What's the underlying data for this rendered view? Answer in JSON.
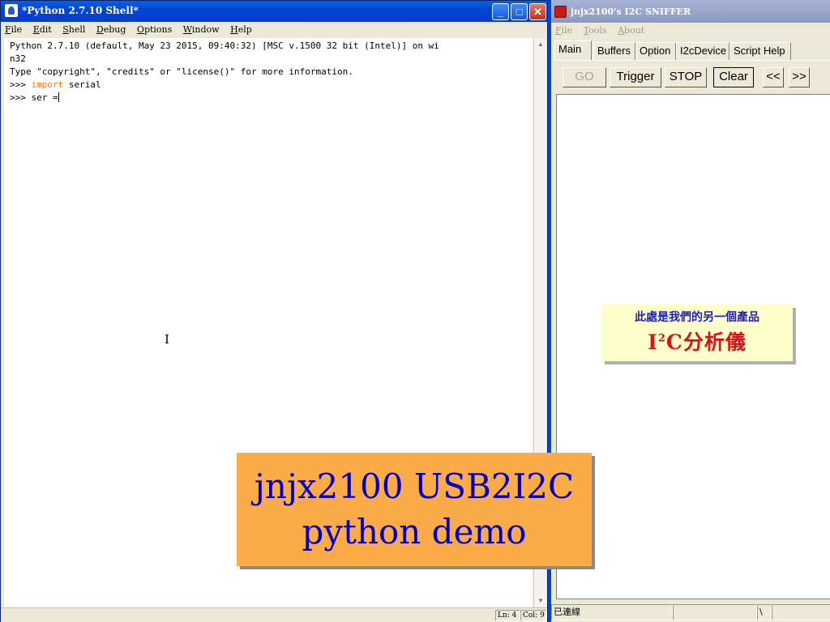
{
  "idle": {
    "title": "*Python 2.7.10 Shell*",
    "window_buttons": {
      "minimize": "_",
      "maximize": "□",
      "close": "✕"
    },
    "menu": [
      "File",
      "Edit",
      "Shell",
      "Debug",
      "Options",
      "Window",
      "Help"
    ],
    "shell_lines": [
      {
        "prompt": "",
        "keyword": "",
        "text": "Python 2.7.10 (default, May 23 2015, 09:40:32) [MSC v.1500 32 bit (Intel)] on wi"
      },
      {
        "prompt": "",
        "keyword": "",
        "text": "n32"
      },
      {
        "prompt": "",
        "keyword": "",
        "text": "Type \"copyright\", \"credits\" or \"license()\" for more information."
      },
      {
        "prompt": ">>> ",
        "keyword": "import",
        "text": " serial"
      },
      {
        "prompt": ">>> ",
        "keyword": "",
        "text": "ser ="
      }
    ],
    "status": {
      "ln": "Ln: 4",
      "col": "Col: 9"
    }
  },
  "sniffer": {
    "title": "jnjx2100's I2C SNIFFER",
    "menu": [
      "File",
      "Tools",
      "About"
    ],
    "tabs": [
      "Main",
      "Buffers",
      "Option",
      "I2cDevice",
      "Script Help"
    ],
    "active_tab": "Main",
    "buttons": {
      "go": "GO",
      "trigger": "Trigger",
      "stop": "STOP",
      "clear": "Clear",
      "prev": "<<",
      "next": ">>"
    },
    "status": {
      "connection": "已連線",
      "slash": "\\"
    }
  },
  "overlay": {
    "note_line1": "此處是我們的另一個產品",
    "note_line2_prefix": "I",
    "note_line2_sup": "2",
    "note_line2_rest": "C分析儀",
    "banner_line1": "jnjx2100 USB2I2C",
    "banner_line2": "python demo"
  },
  "colors": {
    "keyword": "#ff7700",
    "banner_bg": "#fbac49",
    "banner_text": "#0000c8",
    "note_bg": "#ffffcc"
  }
}
